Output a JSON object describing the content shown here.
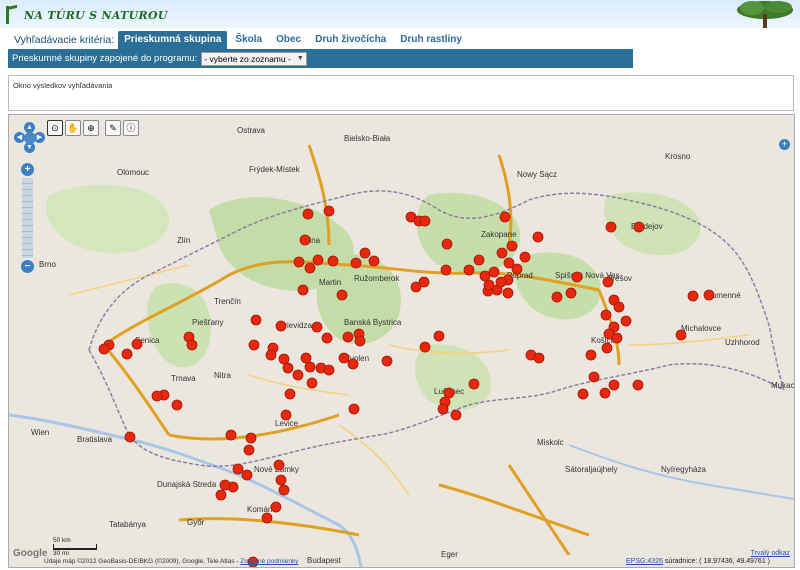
{
  "header": {
    "logo_text": "NA TÚRU S NATUROU"
  },
  "tabs": {
    "label": "Vyhľadávacie kritéria:",
    "items": [
      {
        "label": "Prieskumná skupina",
        "active": true
      },
      {
        "label": "Škola"
      },
      {
        "label": "Obec"
      },
      {
        "label": "Druh živočícha"
      },
      {
        "label": "Druh rastliny"
      }
    ]
  },
  "filter": {
    "label": "Prieskumné skupiny zapojené do programu:",
    "select_value": "- vyberte zo zoznamu -"
  },
  "results": {
    "label": "Okno výsledkov vyhľadávania"
  },
  "map": {
    "colors": {
      "marker": "#e8280c",
      "marker_edge": "#a11606",
      "border": "#8e7fa6",
      "forest": "#c4dca7",
      "road": "#f2b134",
      "road_edge": "#e0a022",
      "water": "#a9c5e8"
    },
    "cities": [
      {
        "name": "Ostrava"
      },
      {
        "name": "Bielsko-Biała"
      },
      {
        "name": "Frýdek-Místek"
      },
      {
        "name": "Olomouc"
      },
      {
        "name": "Zlín"
      },
      {
        "name": "Brno"
      },
      {
        "name": "Žilina"
      },
      {
        "name": "Trenčín"
      },
      {
        "name": "Ružomberok"
      },
      {
        "name": "Nowy Sącz"
      },
      {
        "name": "Krosno"
      },
      {
        "name": "Prešov"
      },
      {
        "name": "Košice"
      },
      {
        "name": "Uzhhorod"
      },
      {
        "name": "Poprad"
      },
      {
        "name": "Banská Bystrica"
      },
      {
        "name": "Nitra"
      },
      {
        "name": "Trnava"
      },
      {
        "name": "Bratislava"
      },
      {
        "name": "Wien"
      },
      {
        "name": "Győr"
      },
      {
        "name": "Miskolc"
      },
      {
        "name": "Nyíregyháza"
      },
      {
        "name": "Budapest"
      },
      {
        "name": "Zvolen"
      },
      {
        "name": "Lučenec"
      },
      {
        "name": "Spišská Nová Ves"
      },
      {
        "name": "Michalovce"
      },
      {
        "name": "Komárno"
      },
      {
        "name": "Dunajská Streda"
      },
      {
        "name": "Nové Zámky"
      },
      {
        "name": "Levice"
      },
      {
        "name": "Martin"
      },
      {
        "name": "Prievidza"
      },
      {
        "name": "Piešťany"
      },
      {
        "name": "Senica"
      },
      {
        "name": "Humenné"
      },
      {
        "name": "Bardejov"
      },
      {
        "name": "Zakopane"
      },
      {
        "name": "Tatabánya"
      },
      {
        "name": "Eger"
      },
      {
        "name": "Mukacheve"
      },
      {
        "name": "Sátoraljaújhely"
      }
    ],
    "attribution": "Údaje máp ©2012 GeoBasis-DE/BKG (©2009), Google, Tele Atlas",
    "terms_inline": "Zmluvné podmienky",
    "scale_km": "50 km",
    "scale_mi": "30 mi",
    "coords_label": "súradnice: ( 18.97436, 49.49761 )",
    "epsg": "EPSG:4326",
    "terms_link": "Trvalý odkaz",
    "google": "Google"
  }
}
